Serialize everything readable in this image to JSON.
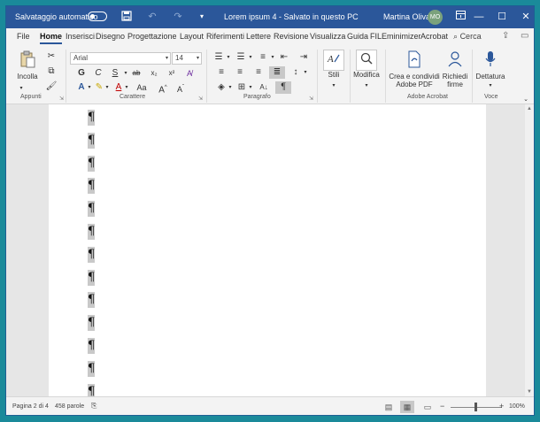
{
  "titlebar": {
    "autosave_label": "Salvataggio automatico",
    "doc_title": "Lorem ipsum 4  -  Salvato in questo PC",
    "user_name": "Martina Oliva",
    "user_initials": "MO"
  },
  "tabs": [
    {
      "label": "File"
    },
    {
      "label": "Home"
    },
    {
      "label": "Inserisci"
    },
    {
      "label": "Disegno"
    },
    {
      "label": "Progettazione"
    },
    {
      "label": "Layout"
    },
    {
      "label": "Riferimenti"
    },
    {
      "label": "Lettere"
    },
    {
      "label": "Revisione"
    },
    {
      "label": "Visualizza"
    },
    {
      "label": "Guida"
    },
    {
      "label": "FILEminimizer"
    },
    {
      "label": "Acrobat"
    }
  ],
  "search_label": "Cerca",
  "ribbon": {
    "clipboard": {
      "paste_label": "Incolla",
      "group_label": "Appunti"
    },
    "font": {
      "font_name": "Arial",
      "font_size": "14",
      "group_label": "Carattere"
    },
    "paragraph": {
      "group_label": "Paragrafo"
    },
    "styles": {
      "label": "Stili"
    },
    "editing": {
      "label": "Modifica"
    },
    "acrobat": {
      "create_pdf_line1": "Crea e condividi",
      "create_pdf_line2": "Adobe PDF",
      "signatures_line1": "Richiedi",
      "signatures_line2": "firme",
      "group_label": "Adobe Acrobat"
    },
    "voice": {
      "dictate_label": "Dettatura",
      "group_label": "Voce"
    }
  },
  "document": {
    "pilcrow": "¶",
    "paragraph_marks": 13
  },
  "statusbar": {
    "page_info": "Pagina 2 di 4",
    "word_count": "458 parole",
    "zoom": "100%",
    "zoom_minus": "−",
    "zoom_plus": "+"
  },
  "colors": {
    "accent": "#2b579a",
    "window_bg": "#1a8a9a",
    "avatar": "#7ba27c"
  }
}
